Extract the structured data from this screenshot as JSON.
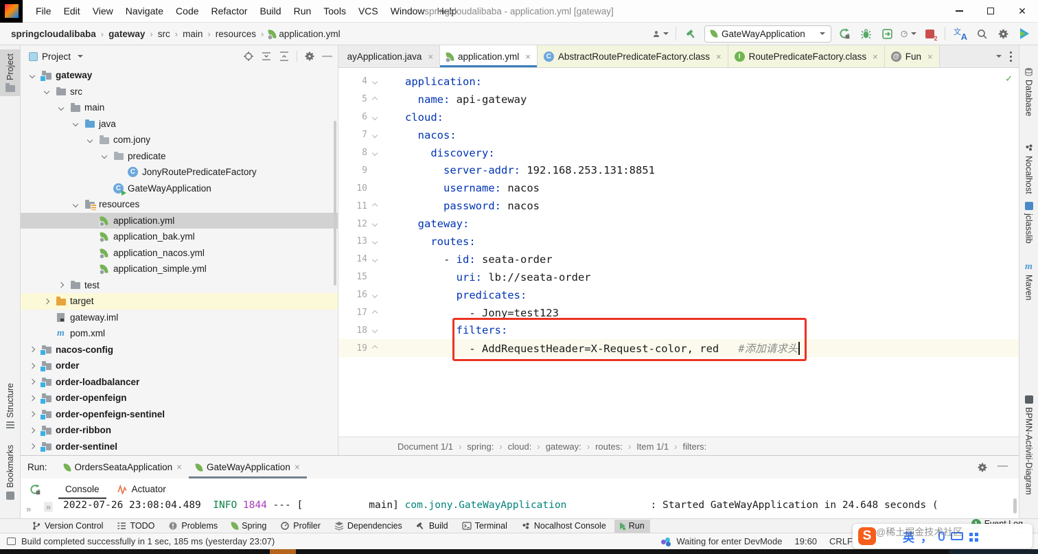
{
  "window": {
    "title": "springcloudalibaba - application.yml [gateway]",
    "menu": [
      "File",
      "Edit",
      "View",
      "Navigate",
      "Code",
      "Refactor",
      "Build",
      "Run",
      "Tools",
      "VCS",
      "Window",
      "Help"
    ]
  },
  "toolbar": {
    "breadcrumbs": [
      "springcloudalibaba",
      "gateway",
      "src",
      "main",
      "resources",
      "application.yml"
    ],
    "run_config": "GateWayApplication"
  },
  "left_stripe": [
    {
      "label": "Project",
      "icon": "folder",
      "active": true
    },
    {
      "label": "Structure",
      "icon": "structure",
      "active": false
    },
    {
      "label": "Bookmarks",
      "icon": "bookmarks",
      "active": false
    }
  ],
  "right_stripe": [
    {
      "label": "Database",
      "icon": "database"
    },
    {
      "label": "Nocalhost",
      "icon": "nocalhost"
    },
    {
      "label": "jclasslib",
      "icon": "jclasslib"
    },
    {
      "label": "Maven",
      "icon": "maven"
    },
    {
      "label": "BPMN-Activiti-Diagram",
      "icon": "bpmn"
    }
  ],
  "project_panel": {
    "title": "Project",
    "tree": [
      {
        "d": 0,
        "label": "gateway",
        "icon": "module",
        "state": "open",
        "bold": true
      },
      {
        "d": 1,
        "label": "src",
        "icon": "folder",
        "state": "open"
      },
      {
        "d": 2,
        "label": "main",
        "icon": "folder",
        "state": "open"
      },
      {
        "d": 3,
        "label": "java",
        "icon": "folder-java",
        "state": "open"
      },
      {
        "d": 4,
        "label": "com.jony",
        "icon": "package",
        "state": "open"
      },
      {
        "d": 5,
        "label": "predicate",
        "icon": "package",
        "state": "open"
      },
      {
        "d": 6,
        "label": "JonyRoutePredicateFactory",
        "icon": "class",
        "state": "leaf"
      },
      {
        "d": 5,
        "label": "GateWayApplication",
        "icon": "class-run",
        "state": "leaf"
      },
      {
        "d": 3,
        "label": "resources",
        "icon": "folder-resources",
        "state": "open"
      },
      {
        "d": 4,
        "label": "application.yml",
        "icon": "yaml",
        "state": "leaf",
        "selected": true
      },
      {
        "d": 4,
        "label": "application_bak.yml",
        "icon": "yaml",
        "state": "leaf"
      },
      {
        "d": 4,
        "label": "application_nacos.yml",
        "icon": "yaml",
        "state": "leaf"
      },
      {
        "d": 4,
        "label": "application_simple.yml",
        "icon": "yaml",
        "state": "leaf"
      },
      {
        "d": 2,
        "label": "test",
        "icon": "folder",
        "state": "closed"
      },
      {
        "d": 1,
        "label": "target",
        "icon": "folder-excluded",
        "state": "closed",
        "highlight": true
      },
      {
        "d": 1,
        "label": "gateway.iml",
        "icon": "iml",
        "state": "leaf"
      },
      {
        "d": 1,
        "label": "pom.xml",
        "icon": "maven",
        "state": "leaf"
      },
      {
        "d": 0,
        "label": "nacos-config",
        "icon": "module",
        "state": "closed",
        "bold": true
      },
      {
        "d": 0,
        "label": "order",
        "icon": "module",
        "state": "closed",
        "bold": true
      },
      {
        "d": 0,
        "label": "order-loadbalancer",
        "icon": "module",
        "state": "closed",
        "bold": true
      },
      {
        "d": 0,
        "label": "order-openfeign",
        "icon": "module",
        "state": "closed",
        "bold": true
      },
      {
        "d": 0,
        "label": "order-openfeign-sentinel",
        "icon": "module",
        "state": "closed",
        "bold": true
      },
      {
        "d": 0,
        "label": "order-ribbon",
        "icon": "module",
        "state": "closed",
        "bold": true
      },
      {
        "d": 0,
        "label": "order-sentinel",
        "icon": "module",
        "state": "closed",
        "bold": true
      }
    ]
  },
  "editor": {
    "tabs": [
      {
        "label": "ayApplication.java",
        "icon": "",
        "cut": true
      },
      {
        "label": "application.yml",
        "icon": "yaml",
        "active": true
      },
      {
        "label": "AbstractRoutePredicateFactory.class",
        "icon": "class",
        "lib": true
      },
      {
        "label": "RoutePredicateFactory.class",
        "icon": "interface",
        "lib": true
      },
      {
        "label": "Fun",
        "icon": "annotation",
        "lib": true
      }
    ],
    "lines": [
      {
        "n": 4,
        "fold": "d",
        "parts": [
          {
            "c": "key",
            "t": "application:"
          }
        ]
      },
      {
        "n": 5,
        "fold": "u",
        "parts": [
          {
            "c": "val",
            "t": "  "
          },
          {
            "c": "key",
            "t": "name:"
          },
          {
            "c": "val",
            "t": " api-gateway"
          }
        ]
      },
      {
        "n": 6,
        "fold": "d",
        "parts": [
          {
            "c": "key",
            "t": "cloud:"
          }
        ]
      },
      {
        "n": 7,
        "fold": "d",
        "parts": [
          {
            "c": "val",
            "t": "  "
          },
          {
            "c": "key",
            "t": "nacos:"
          }
        ]
      },
      {
        "n": 8,
        "fold": "d",
        "parts": [
          {
            "c": "val",
            "t": "    "
          },
          {
            "c": "key",
            "t": "discovery:"
          }
        ]
      },
      {
        "n": 9,
        "fold": "",
        "parts": [
          {
            "c": "val",
            "t": "      "
          },
          {
            "c": "key",
            "t": "server-addr:"
          },
          {
            "c": "val",
            "t": " 192.168.253.131:8851"
          }
        ]
      },
      {
        "n": 10,
        "fold": "",
        "parts": [
          {
            "c": "val",
            "t": "      "
          },
          {
            "c": "key",
            "t": "username:"
          },
          {
            "c": "val",
            "t": " nacos"
          }
        ]
      },
      {
        "n": 11,
        "fold": "u",
        "parts": [
          {
            "c": "val",
            "t": "      "
          },
          {
            "c": "key",
            "t": "password:"
          },
          {
            "c": "val",
            "t": " nacos"
          }
        ]
      },
      {
        "n": 12,
        "fold": "d",
        "parts": [
          {
            "c": "val",
            "t": "  "
          },
          {
            "c": "key",
            "t": "gateway:"
          }
        ]
      },
      {
        "n": 13,
        "fold": "d",
        "parts": [
          {
            "c": "val",
            "t": "    "
          },
          {
            "c": "key",
            "t": "routes:"
          }
        ]
      },
      {
        "n": 14,
        "fold": "d",
        "parts": [
          {
            "c": "val",
            "t": "      - "
          },
          {
            "c": "key",
            "t": "id:"
          },
          {
            "c": "val",
            "t": " seata-order"
          }
        ]
      },
      {
        "n": 15,
        "fold": "",
        "parts": [
          {
            "c": "val",
            "t": "        "
          },
          {
            "c": "key",
            "t": "uri:"
          },
          {
            "c": "val",
            "t": " lb://seata-order"
          }
        ]
      },
      {
        "n": 16,
        "fold": "d",
        "parts": [
          {
            "c": "val",
            "t": "        "
          },
          {
            "c": "key",
            "t": "predicates:"
          }
        ]
      },
      {
        "n": 17,
        "fold": "u",
        "parts": [
          {
            "c": "val",
            "t": "          - Jony=test123"
          }
        ]
      },
      {
        "n": 18,
        "fold": "d",
        "parts": [
          {
            "c": "val",
            "t": "        "
          },
          {
            "c": "key",
            "t": "filters:"
          }
        ]
      },
      {
        "n": 19,
        "fold": "u",
        "cur": true,
        "caret": true,
        "parts": [
          {
            "c": "val",
            "t": "          - AddRequestHeader=X-Request-color, red   "
          },
          {
            "c": "com",
            "t": "#添加请求头"
          }
        ]
      }
    ],
    "breadcrumb": [
      "Document 1/1",
      "spring:",
      "cloud:",
      "gateway:",
      "routes:",
      "Item 1/1",
      "filters:"
    ]
  },
  "run_panel": {
    "label": "Run:",
    "tabs": [
      {
        "label": "OrdersSeataApplication",
        "active": false
      },
      {
        "label": "GateWayApplication",
        "active": true
      }
    ],
    "views": [
      {
        "label": "Console",
        "active": true
      },
      {
        "label": "Actuator",
        "active": false,
        "icon": "actuator"
      }
    ],
    "log_parts": [
      {
        "c": "t",
        "t": "2022-07-26 23:08:04.489  "
      },
      {
        "c": "lvl",
        "t": "INFO"
      },
      {
        "c": "pid",
        "t": " 1844"
      },
      {
        "c": "t",
        "t": " --- ["
      },
      {
        "c": "t",
        "t": "           main] "
      },
      {
        "c": "logger",
        "t": "com.jony.GateWayApplication"
      },
      {
        "c": "t",
        "t": "              : Started GateWayApplication in 24.648 seconds ("
      }
    ]
  },
  "bottom_bar": {
    "items": [
      {
        "label": "Version Control",
        "icon": "branch"
      },
      {
        "label": "TODO",
        "icon": "todo"
      },
      {
        "label": "Problems",
        "icon": "problems"
      },
      {
        "label": "Spring",
        "icon": "spring"
      },
      {
        "label": "Profiler",
        "icon": "profiler"
      },
      {
        "label": "Dependencies",
        "icon": "dependencies"
      },
      {
        "label": "Build",
        "icon": "hammer"
      },
      {
        "label": "Terminal",
        "icon": "terminal"
      },
      {
        "label": "Nocalhost Console",
        "icon": "nocalhost"
      },
      {
        "label": "Run",
        "icon": "run",
        "active": true
      }
    ],
    "event_log": "Event Log",
    "event_badge": "1"
  },
  "status_bar": {
    "left_message": "Build completed successfully in 1 sec, 185 ms (yesterday 23:07)",
    "devmode": "Waiting for enter DevMode",
    "position": "19:60",
    "line_ending": "CRLF"
  },
  "watermark": {
    "logo": "S",
    "text": "@稀土掘金技术社区",
    "ime_lang": "英",
    "ime_comma": "，"
  },
  "colors": {
    "yaml_key": "#0033b3",
    "comment": "#8c8c8c",
    "annotation_box": "#ec3323",
    "active_tab_underline": "#3d7ebd",
    "log_info": "#0a8043",
    "log_pid": "#a839c0",
    "log_logger": "#00827b",
    "selection_row": "#d2d2d2",
    "excluded_row": "#fcf9d8"
  }
}
